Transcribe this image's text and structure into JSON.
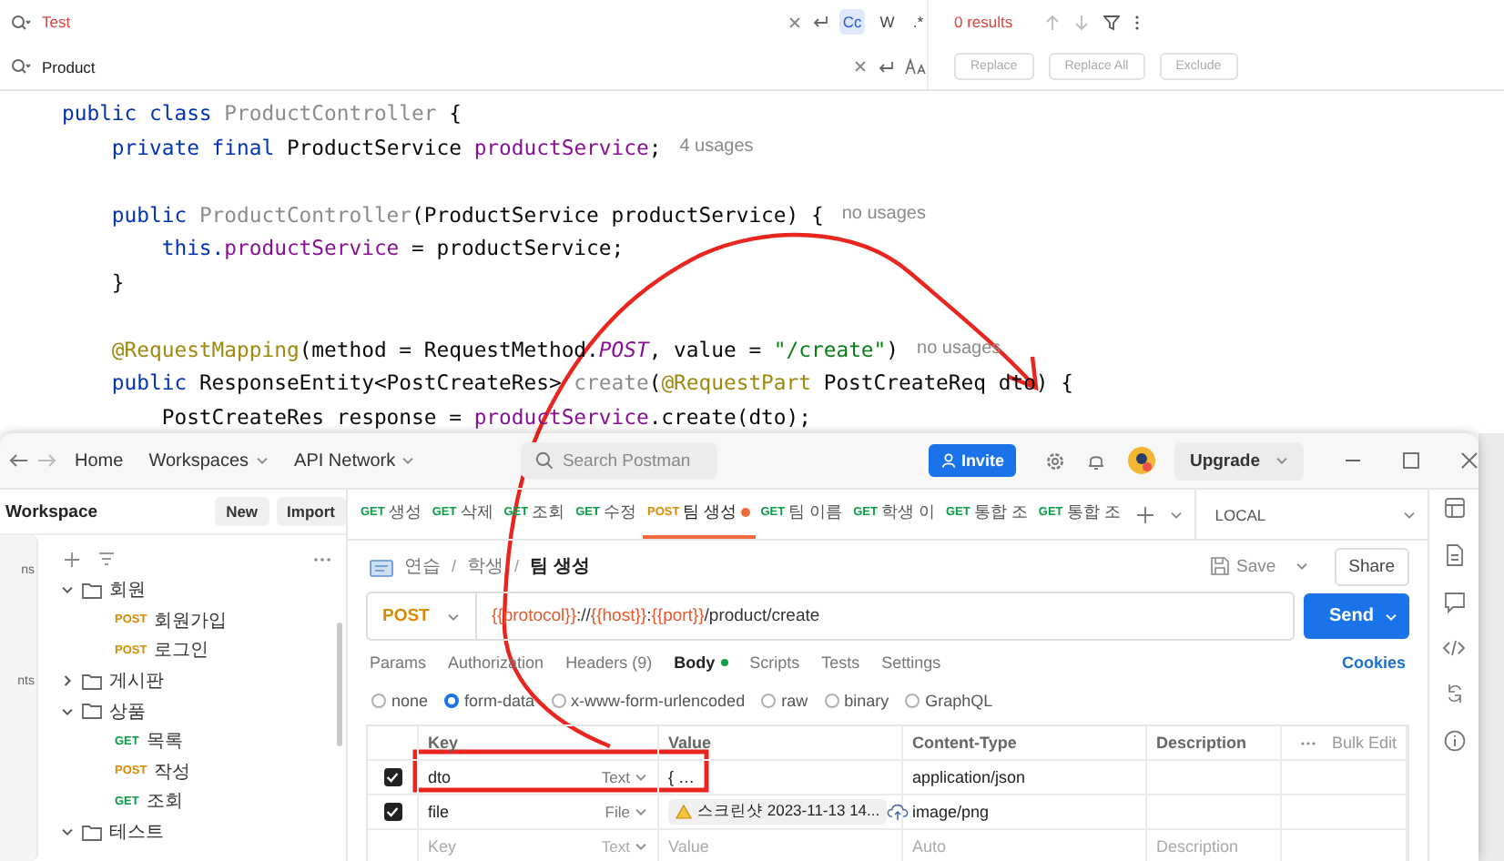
{
  "find_bar": {
    "search": {
      "value": "Test",
      "no_match": true
    },
    "toggles": [
      {
        "label": "Cc",
        "selected": true
      },
      {
        "label": "W",
        "selected": false
      },
      {
        "label": ".*",
        "selected": false
      }
    ],
    "results": "0 results",
    "replace": {
      "value": "Product"
    },
    "buttons": [
      {
        "label": "Replace",
        "disabled": true
      },
      {
        "label": "Replace All",
        "disabled": true
      },
      {
        "label": "Exclude",
        "disabled": true
      }
    ]
  },
  "editor": {
    "lines": [
      {
        "kind": "code",
        "tokens": [
          {
            "kind": "keyword",
            "text": "public class "
          },
          {
            "kind": "unused",
            "text": "ProductController"
          },
          {
            "kind": "plain",
            "text": " {"
          }
        ]
      },
      {
        "kind": "code",
        "tokens": [
          {
            "kind": "keyword",
            "text": "    private final "
          },
          {
            "kind": "plain",
            "text": "ProductService "
          },
          {
            "kind": "field",
            "text": "productService"
          },
          {
            "kind": "plain",
            "text": ";"
          }
        ],
        "hint": "4 usages"
      },
      {
        "kind": "blank"
      },
      {
        "kind": "code",
        "tokens": [
          {
            "kind": "keyword",
            "text": "    public "
          },
          {
            "kind": "unused",
            "text": "ProductController"
          },
          {
            "kind": "plain",
            "text": "(ProductService productService) {"
          }
        ],
        "hint": "no usages"
      },
      {
        "kind": "code",
        "tokens": [
          {
            "kind": "keyword",
            "text": "        this."
          },
          {
            "kind": "field",
            "text": "productService"
          },
          {
            "kind": "plain",
            "text": " = productService;"
          }
        ]
      },
      {
        "kind": "code",
        "tokens": [
          {
            "kind": "plain",
            "text": "    }"
          }
        ]
      },
      {
        "kind": "blank"
      },
      {
        "kind": "code",
        "tokens": [
          {
            "kind": "annotation",
            "text": "    @RequestMapping"
          },
          {
            "kind": "plain",
            "text": "(method = RequestMethod."
          },
          {
            "kind": "constant",
            "text": "POST"
          },
          {
            "kind": "plain",
            "text": ", value = "
          },
          {
            "kind": "string",
            "text": "\"/create\""
          },
          {
            "kind": "plain",
            "text": ")"
          }
        ],
        "hint": "no usages"
      },
      {
        "kind": "code",
        "tokens": [
          {
            "kind": "keyword",
            "text": "    public "
          },
          {
            "kind": "plain",
            "text": "ResponseEntity<PostCreateRes> "
          },
          {
            "kind": "unused",
            "text": "create"
          },
          {
            "kind": "plain",
            "text": "("
          },
          {
            "kind": "annotation",
            "text": "@RequestPart"
          },
          {
            "kind": "plain",
            "text": " PostCreateReq dto) {"
          }
        ]
      },
      {
        "kind": "code",
        "tokens": [
          {
            "kind": "plain",
            "text": "        PostCreateRes response = "
          },
          {
            "kind": "field",
            "text": "productService"
          },
          {
            "kind": "plain",
            "text": ".create(dto);"
          }
        ]
      }
    ]
  },
  "postman": {
    "nav": {
      "links": [
        {
          "label": "Home",
          "dropdown": false
        },
        {
          "label": "Workspaces",
          "dropdown": true
        },
        {
          "label": "API Network",
          "dropdown": true
        }
      ],
      "search_placeholder": "Search Postman",
      "invite": "Invite",
      "upgrade": "Upgrade"
    },
    "sidebar": {
      "title": "Workspace",
      "buttons": [
        "New",
        "Import"
      ],
      "rail_labels": [
        "ns",
        "nts"
      ],
      "tree": [
        {
          "kind": "folder",
          "name": "회원",
          "expanded": true,
          "children": [
            {
              "kind": "request",
              "method": "POST",
              "name": "회원가입"
            },
            {
              "kind": "request",
              "method": "POST",
              "name": "로그인"
            }
          ]
        },
        {
          "kind": "folder",
          "name": "게시판",
          "expanded": false
        },
        {
          "kind": "folder",
          "name": "상품",
          "expanded": true,
          "children": [
            {
              "kind": "request",
              "method": "GET",
              "name": "목록"
            },
            {
              "kind": "request",
              "method": "POST",
              "name": "작성"
            },
            {
              "kind": "request",
              "method": "GET",
              "name": "조회"
            }
          ]
        },
        {
          "kind": "folder",
          "name": "테스트",
          "expanded": true
        }
      ]
    },
    "tabs": [
      {
        "method": "GET",
        "label": "생성",
        "selected": false,
        "unsaved": false
      },
      {
        "method": "GET",
        "label": "삭제",
        "selected": false,
        "unsaved": false
      },
      {
        "method": "GET",
        "label": "조회",
        "selected": false,
        "unsaved": false
      },
      {
        "method": "GET",
        "label": "수정",
        "selected": false,
        "unsaved": false
      },
      {
        "method": "POST",
        "label": "팀 생성",
        "selected": true,
        "unsaved": true
      },
      {
        "method": "GET",
        "label": "팀 이름",
        "selected": false,
        "unsaved": false
      },
      {
        "method": "GET",
        "label": "학생 이",
        "selected": false,
        "unsaved": false
      },
      {
        "method": "GET",
        "label": "통합 조",
        "selected": false,
        "unsaved": false
      },
      {
        "method": "GET",
        "label": "통합 조",
        "selected": false,
        "unsaved": false
      }
    ],
    "environment": "LOCAL",
    "breadcrumb": [
      "연습",
      "학생",
      "팀 생성"
    ],
    "breadcrumb_separator": "/",
    "save": "Save",
    "share": "Share",
    "request": {
      "method": "POST",
      "url": [
        {
          "kind": "variable",
          "text": "{{protocol}}"
        },
        {
          "kind": "text",
          "text": "://"
        },
        {
          "kind": "variable",
          "text": "{{host}}"
        },
        {
          "kind": "text",
          "text": ":"
        },
        {
          "kind": "variable",
          "text": "{{port}}"
        },
        {
          "kind": "text",
          "text": "/product/create"
        }
      ],
      "send": "Send"
    },
    "request_tabs": [
      {
        "label": "Params",
        "selected": false,
        "indicator": false
      },
      {
        "label": "Authorization",
        "selected": false,
        "indicator": false
      },
      {
        "label": "Headers (9)",
        "selected": false,
        "indicator": false
      },
      {
        "label": "Body",
        "selected": true,
        "indicator": true
      },
      {
        "label": "Scripts",
        "selected": false,
        "indicator": false
      },
      {
        "label": "Tests",
        "selected": false,
        "indicator": false
      },
      {
        "label": "Settings",
        "selected": false,
        "indicator": false
      }
    ],
    "cookies": "Cookies",
    "body_types": [
      {
        "label": "none",
        "selected": false
      },
      {
        "label": "form-data",
        "selected": true
      },
      {
        "label": "x-www-form-urlencoded",
        "selected": false
      },
      {
        "label": "raw",
        "selected": false
      },
      {
        "label": "binary",
        "selected": false
      },
      {
        "label": "GraphQL",
        "selected": false
      }
    ],
    "form_table": {
      "columns": [
        "Key",
        "Value",
        "Content-Type",
        "Description"
      ],
      "bulk_edit": "Bulk Edit",
      "rows": [
        {
          "kind": "text",
          "checked": true,
          "key": "dto",
          "type": "Text",
          "value": "{ …",
          "content_type": "application/json"
        },
        {
          "kind": "file",
          "checked": true,
          "key": "file",
          "type": "File",
          "value": "스크린샷 2023-11-13 14...",
          "content_type": "image/png"
        }
      ],
      "new_row": {
        "key": {
          "placeholder": "Key"
        },
        "type": "Text",
        "value": {
          "placeholder": "Value"
        },
        "content_type": {
          "placeholder": "Auto"
        },
        "description": {
          "placeholder": "Description"
        }
      }
    }
  }
}
